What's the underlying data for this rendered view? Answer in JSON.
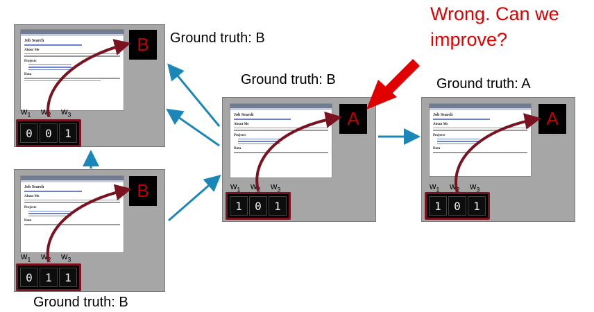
{
  "callout": {
    "line1": "Wrong. Can we",
    "line2": "improve?"
  },
  "panels": [
    {
      "ground_truth": "Ground truth: B",
      "label": "B",
      "features": [
        "0",
        "0",
        "1"
      ]
    },
    {
      "ground_truth": "Ground truth: B",
      "label": "B",
      "features": [
        "0",
        "1",
        "1"
      ]
    },
    {
      "ground_truth": "Ground truth: B",
      "label": "A",
      "features": [
        "1",
        "0",
        "1"
      ]
    },
    {
      "ground_truth": "Ground truth: A",
      "label": "A",
      "features": [
        "1",
        "0",
        "1"
      ]
    }
  ],
  "weight_labels": {
    "w": "w",
    "sub1": "1",
    "sub2": "2",
    "sub3": "3"
  },
  "colors": {
    "arrow": "#1b87b8",
    "red_arrow": "#e00000",
    "curve": "#7a1220",
    "label": "#c00000",
    "panel": "#a6a6a6"
  }
}
